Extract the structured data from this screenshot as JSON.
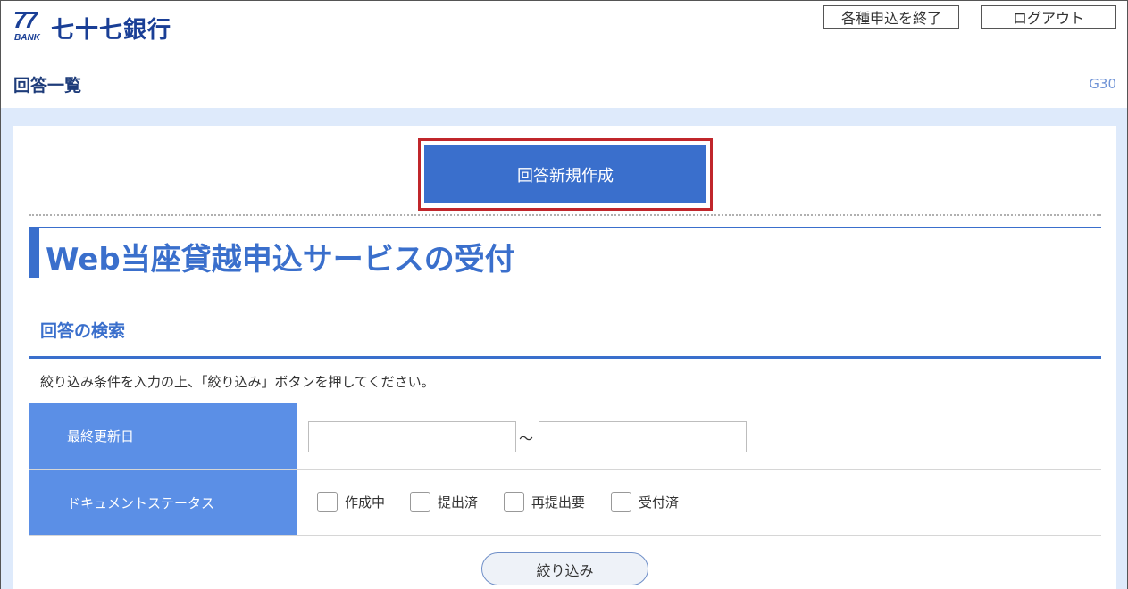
{
  "header": {
    "logo_number": "77",
    "logo_bank": "BANK",
    "logo_name": "七十七銀行",
    "end_button": "各種申込を終了",
    "logout_button": "ログアウト",
    "page_title": "回答一覧",
    "page_code": "G30"
  },
  "actions": {
    "new_answer_button": "回答新規作成"
  },
  "section": {
    "title": "Web当座貸越申込サービスの受付",
    "search_title": "回答の検索",
    "instruction": "絞り込み条件を入力の上、「絞り込み」ボタンを押してください。"
  },
  "form": {
    "last_updated_label": "最終更新日",
    "date_from_value": "",
    "date_to_value": "",
    "range_separator": "～",
    "status_label": "ドキュメントステータス",
    "status_options": [
      {
        "label": "作成中",
        "checked": false
      },
      {
        "label": "提出済",
        "checked": false
      },
      {
        "label": "再提出要",
        "checked": false
      },
      {
        "label": "受付済",
        "checked": false
      }
    ],
    "filter_button": "絞り込み"
  },
  "colors": {
    "brand": "#1a3f96",
    "accent": "#3a6fcc",
    "label_bg": "#5b8fe6",
    "highlight": "#c0262b",
    "band": "#deeafb"
  }
}
